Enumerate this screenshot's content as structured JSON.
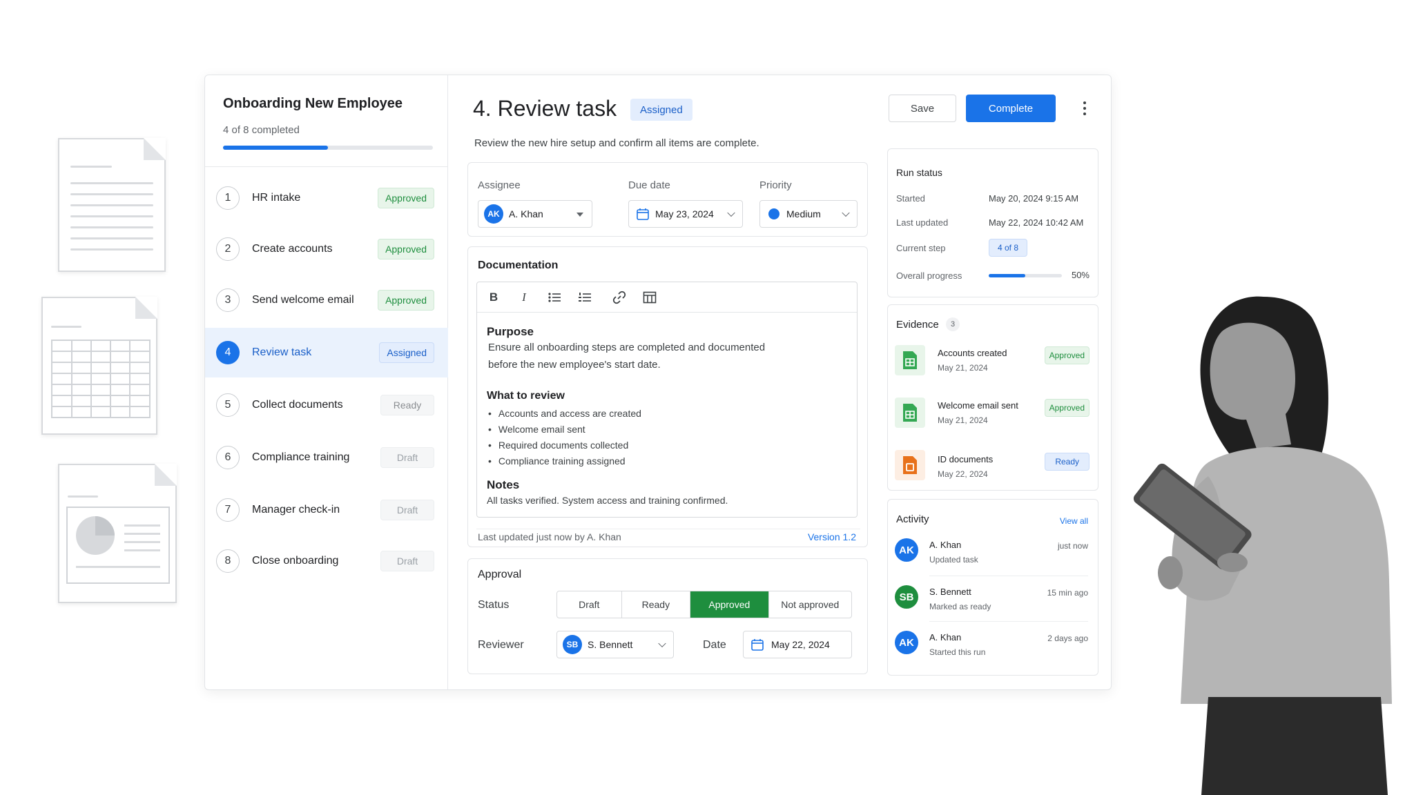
{
  "workflow": {
    "title": "Onboarding New Employee",
    "progress_text": "4 of 8 completed",
    "progress_fraction": 0.5,
    "steps": [
      {
        "num": "1",
        "label": "HR intake",
        "status": "Approved"
      },
      {
        "num": "2",
        "label": "Create accounts",
        "status": "Approved"
      },
      {
        "num": "3",
        "label": "Send welcome email",
        "status": "Approved"
      },
      {
        "num": "4",
        "label": "Review task",
        "status": "Assigned"
      },
      {
        "num": "5",
        "label": "Collect documents",
        "status": "Ready"
      },
      {
        "num": "6",
        "label": "Compliance training",
        "status": "Draft"
      },
      {
        "num": "7",
        "label": "Manager check-in",
        "status": "Draft"
      },
      {
        "num": "8",
        "label": "Close onboarding",
        "status": "Draft"
      }
    ]
  },
  "task": {
    "title": "4. Review task",
    "status": "Assigned",
    "description": "Review the new hire setup and confirm all items are complete."
  },
  "fields": {
    "assignee_label": "Assignee",
    "assignee_initials": "AK",
    "assignee_name": "A. Khan",
    "due_label": "Due date",
    "due_value": "May 23, 2024",
    "priority_label": "Priority",
    "priority_value": "Medium"
  },
  "documentation": {
    "title": "Documentation",
    "toolbar": {
      "bold": "B",
      "italic": "I"
    },
    "purpose_heading": "Purpose",
    "purpose_line1": "Ensure all onboarding steps are completed and documented",
    "purpose_line2": "before the new employee's start date.",
    "review_heading": "What to review",
    "review_items": [
      "Accounts and access are created",
      "Welcome email sent",
      "Required documents collected",
      "Compliance training assigned"
    ],
    "notes_heading": "Notes",
    "notes_text": "All tasks verified. System access and training confirmed.",
    "last_updated": "Last updated just now by A. Khan",
    "version": "Version 1.2"
  },
  "approval": {
    "title": "Approval",
    "status_label": "Status",
    "options": [
      "Draft",
      "Ready",
      "Approved",
      "Not approved"
    ],
    "selected": "Approved",
    "reviewer_label": "Reviewer",
    "reviewer_initials": "SB",
    "reviewer_name": "S. Bennett",
    "date_label": "Date",
    "date_value": "May 22, 2024"
  },
  "actions": {
    "save": "Save",
    "complete": "Complete"
  },
  "run_status": {
    "title": "Run status",
    "started_label": "Started",
    "started_value": "May 20, 2024  9:15 AM",
    "updated_label": "Last updated",
    "updated_value": "May 22, 2024  10:42 AM",
    "step_label": "Current step",
    "step_value": "4 of 8",
    "progress_label": "Overall progress",
    "progress_value": "50%",
    "progress_fraction": 0.5
  },
  "evidence": {
    "title": "Evidence",
    "count": "3",
    "items": [
      {
        "name": "Accounts created",
        "date": "May 21, 2024",
        "status": "Approved"
      },
      {
        "name": "Welcome email sent",
        "date": "May 21, 2024",
        "status": "Approved"
      },
      {
        "name": "ID documents",
        "date": "May 22, 2024",
        "status": "Ready"
      }
    ]
  },
  "activity": {
    "title": "Activity",
    "view_all": "View all",
    "items": [
      {
        "initials": "AK",
        "name": "A. Khan",
        "desc": "Updated task",
        "time": "just now"
      },
      {
        "initials": "SB",
        "name": "S. Bennett",
        "desc": "Marked as ready",
        "time": "15 min ago"
      },
      {
        "initials": "AK",
        "name": "A. Khan",
        "desc": "Started this run",
        "time": "2 days ago"
      }
    ]
  },
  "colors": {
    "accent": "#1a73e8",
    "approved": "#1e8e3e",
    "sheet_icon": "#34a853",
    "doc_icon": "#e8711a"
  }
}
